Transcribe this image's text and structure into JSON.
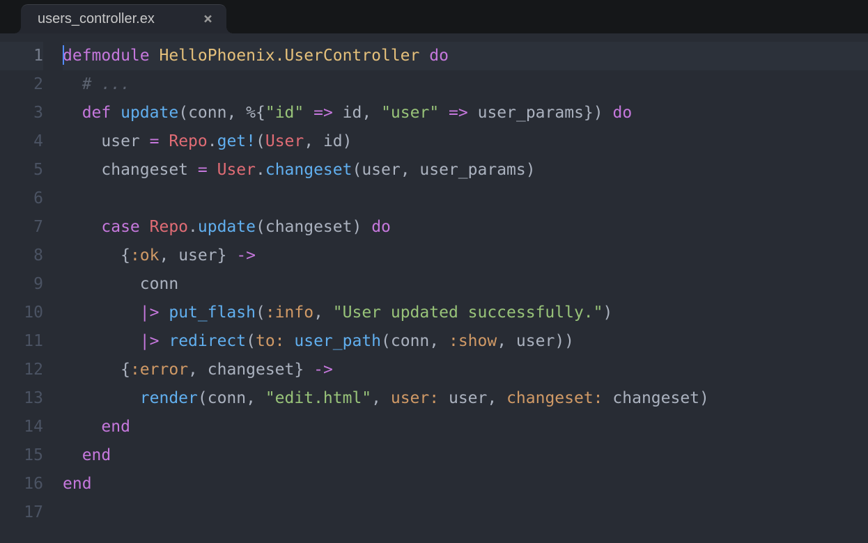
{
  "tab": {
    "title": "users_controller.ex",
    "close": "×"
  },
  "gutter": {
    "l1": "1",
    "l2": "2",
    "l3": "3",
    "l4": "4",
    "l5": "5",
    "l6": "6",
    "l7": "7",
    "l8": "8",
    "l9": "9",
    "l10": "10",
    "l11": "11",
    "l12": "12",
    "l13": "13",
    "l14": "14",
    "l15": "15",
    "l16": "16",
    "l17": "17"
  },
  "code": {
    "l1": {
      "kw1": "defmodule",
      "sp1": " ",
      "cls1": "HelloPhoenix.UserController",
      "sp2": " ",
      "kw2": "do"
    },
    "l2": {
      "ind": "  ",
      "comment": "# ..."
    },
    "l3": {
      "ind": "  ",
      "kw1": "def",
      "sp1": " ",
      "fn1": "update",
      "p1": "(",
      "a1": "conn",
      "c1": ", ",
      "pct": "%{",
      "s1": "\"id\"",
      "sp2": " ",
      "op1": "=>",
      "sp3": " ",
      "a2": "id",
      "c2": ", ",
      "s2": "\"user\"",
      "sp4": " ",
      "op2": "=>",
      "sp5": " ",
      "a3": "user_params",
      "p2": "})",
      "sp6": " ",
      "kw2": "do"
    },
    "l4": {
      "ind": "    ",
      "v1": "user ",
      "op1": "=",
      "sp1": " ",
      "t1": "Repo",
      "d1": ".",
      "fn1": "get!",
      "p1": "(",
      "t2": "User",
      "c1": ", ",
      "a1": "id",
      "p2": ")"
    },
    "l5": {
      "ind": "    ",
      "v1": "changeset ",
      "op1": "=",
      "sp1": " ",
      "t1": "User",
      "d1": ".",
      "fn1": "changeset",
      "p1": "(",
      "a1": "user",
      "c1": ", ",
      "a2": "user_params",
      "p2": ")"
    },
    "l6": {
      "blank": ""
    },
    "l7": {
      "ind": "    ",
      "kw1": "case",
      "sp1": " ",
      "t1": "Repo",
      "d1": ".",
      "fn1": "update",
      "p1": "(",
      "a1": "changeset",
      "p2": ")",
      "sp2": " ",
      "kw2": "do"
    },
    "l8": {
      "ind": "      ",
      "b1": "{",
      "at1": ":ok",
      "c1": ", ",
      "a1": "user",
      "b2": "}",
      "sp1": " ",
      "arr": "->"
    },
    "l9": {
      "ind": "        ",
      "a1": "conn"
    },
    "l10": {
      "ind": "        ",
      "pipe": "|>",
      "sp1": " ",
      "fn1": "put_flash",
      "p1": "(",
      "at1": ":info",
      "c1": ", ",
      "s1": "\"User updated successfully.\"",
      "p2": ")"
    },
    "l11": {
      "ind": "        ",
      "pipe": "|>",
      "sp1": " ",
      "fn1": "redirect",
      "p1": "(",
      "k1": "to:",
      "sp2": " ",
      "fn2": "user_path",
      "p2": "(",
      "a1": "conn",
      "c1": ", ",
      "at1": ":show",
      "c2": ", ",
      "a2": "user",
      "p3": "))"
    },
    "l12": {
      "ind": "      ",
      "b1": "{",
      "at1": ":error",
      "c1": ", ",
      "a1": "changeset",
      "b2": "}",
      "sp1": " ",
      "arr": "->"
    },
    "l13": {
      "ind": "        ",
      "fn1": "render",
      "p1": "(",
      "a1": "conn",
      "c1": ", ",
      "s1": "\"edit.html\"",
      "c2": ", ",
      "k1": "user:",
      "sp1": " ",
      "a2": "user",
      "c3": ", ",
      "k2": "changeset:",
      "sp2": " ",
      "a3": "changeset",
      "p2": ")"
    },
    "l14": {
      "ind": "    ",
      "kw1": "end"
    },
    "l15": {
      "ind": "  ",
      "kw1": "end"
    },
    "l16": {
      "kw1": "end"
    },
    "l17": {
      "blank": ""
    }
  }
}
